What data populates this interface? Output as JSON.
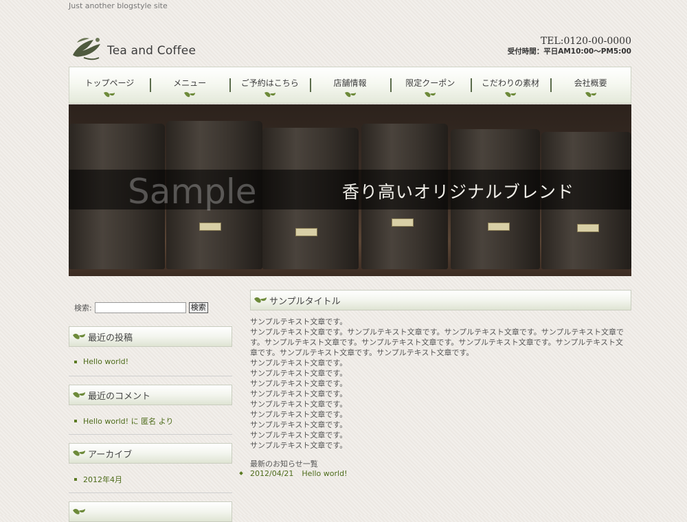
{
  "site": {
    "tagline": "Just another blogstyle site",
    "logo_text": "Tea and Coffee",
    "tel": "TEL:0120-00-0000",
    "hours": "受付時間：平日AM10:00〜PM5:00"
  },
  "nav": {
    "items": [
      {
        "label": "トップページ"
      },
      {
        "label": "メニュー"
      },
      {
        "label": "ご予約はこちら"
      },
      {
        "label": "店舗情報"
      },
      {
        "label": "限定クーポン"
      },
      {
        "label": "こだわりの素材"
      },
      {
        "label": "会社概要"
      }
    ]
  },
  "hero": {
    "watermark": "Sample",
    "caption": "香り高いオリジナルブレンド"
  },
  "sidebar": {
    "search_label": "検索:",
    "search_value": "",
    "search_button": "検索",
    "widgets": [
      {
        "title": "最近の投稿",
        "items": [
          "Hello world!"
        ]
      },
      {
        "title": "最近のコメント",
        "items": [
          "Hello world! に 匿名 より"
        ]
      },
      {
        "title": "アーカイブ",
        "items": [
          "2012年4月"
        ]
      }
    ]
  },
  "main": {
    "post_title": "サンプルタイトル",
    "body_lines": [
      "サンプルテキスト文章です。",
      "サンプルテキスト文章です。サンプルテキスト文章です。サンプルテキスト文章です。サンプルテキスト文章で",
      "す。サンプルテキスト文章です。サンプルテキスト文章です。サンプルテキスト文章です。サンプルテキスト文",
      "章です。サンプルテキスト文章です。サンプルテキスト文章です。",
      "サンプルテキスト文章です。",
      "サンプルテキスト文章です。",
      "サンプルテキスト文章です。",
      "サンプルテキスト文章です。",
      "サンプルテキスト文章です。",
      "サンプルテキスト文章です。",
      "サンプルテキスト文章です。",
      "サンプルテキスト文章です。",
      "サンプルテキスト文章です。"
    ],
    "news_heading": "最新のお知らせ一覧",
    "news": [
      {
        "date": "2012/04/21",
        "title": "Hello world!"
      }
    ]
  },
  "colors": {
    "accent_green": "#4d6b1a",
    "background": "#efebe6"
  }
}
